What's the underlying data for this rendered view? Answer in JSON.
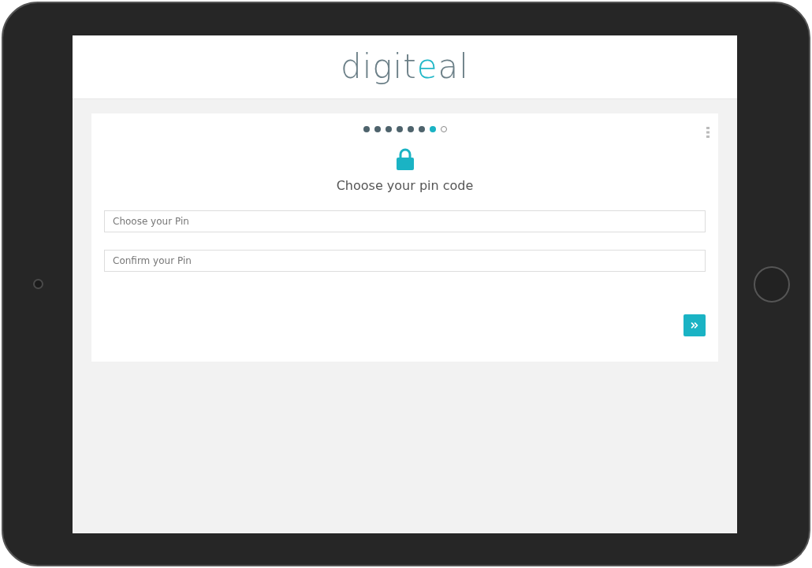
{
  "header": {
    "logo": [
      {
        "text": "digit",
        "accent": false
      },
      {
        "text": "e",
        "accent": true
      },
      {
        "text": "al",
        "accent": false
      }
    ]
  },
  "steps": [
    {
      "done": true,
      "selected": false
    },
    {
      "done": true,
      "selected": false
    },
    {
      "done": true,
      "selected": false
    },
    {
      "done": true,
      "selected": false
    },
    {
      "done": true,
      "selected": false
    },
    {
      "done": true,
      "selected": false
    },
    {
      "done": false,
      "selected": true
    },
    {
      "done": false,
      "selected": false
    }
  ],
  "card": {
    "title": "Choose your pin code",
    "fields": [
      {
        "placeholder": "Choose your Pin"
      },
      {
        "placeholder": "Confirm your Pin"
      }
    ]
  }
}
